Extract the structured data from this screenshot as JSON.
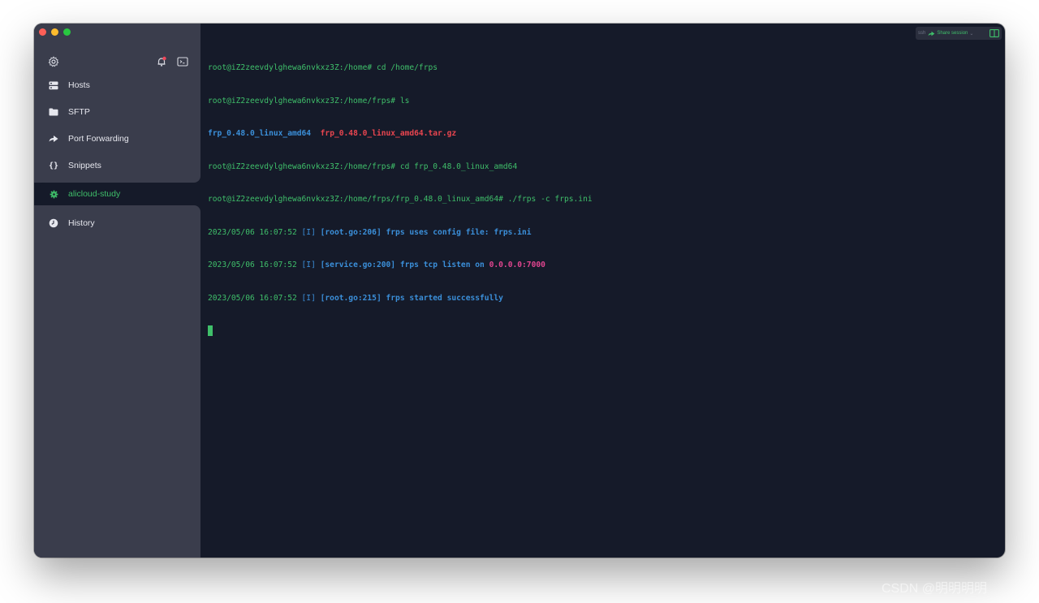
{
  "window": {
    "title": ""
  },
  "sidebar": {
    "nav": [
      {
        "label": "Hosts",
        "icon": "hosts-icon"
      },
      {
        "label": "SFTP",
        "icon": "folder-icon"
      },
      {
        "label": "Port Forwarding",
        "icon": "forward-arrow-icon"
      },
      {
        "label": "Snippets",
        "icon": "braces-icon"
      }
    ],
    "session": {
      "label": "alicloud-study",
      "icon": "gear-icon"
    },
    "history": {
      "label": "History",
      "icon": "clock-icon"
    }
  },
  "toolbar": {
    "tag": "ssh",
    "share_label": "Share session",
    "chevron": "⌄"
  },
  "terminal": {
    "lines": [
      {
        "prompt": "root@iZ2zeevdylghewa6nvkxz3Z:/home#",
        "cmd": " cd /home/frps"
      },
      {
        "prompt": "root@iZ2zeevdylghewa6nvkxz3Z:/home/frps#",
        "cmd": " ls"
      },
      {
        "dir": "frp_0.48.0_linux_amd64",
        "sep": "  ",
        "archive": "frp_0.48.0_linux_amd64.tar.gz"
      },
      {
        "prompt": "root@iZ2zeevdylghewa6nvkxz3Z:/home/frps#",
        "cmd": " cd frp_0.48.0_linux_amd64"
      },
      {
        "prompt": "root@iZ2zeevdylghewa6nvkxz3Z:/home/frps/frp_0.48.0_linux_amd64#",
        "cmd": " ./frps -c frps.ini"
      },
      {
        "ts": "2023/05/06 16:07:52",
        "lvl": " [I]",
        "src": " [root.go:206]",
        "msg": " frps uses config file: frps.ini",
        "hl": ""
      },
      {
        "ts": "2023/05/06 16:07:52",
        "lvl": " [I]",
        "src": " [service.go:200]",
        "msg": " frps tcp listen on ",
        "hl": "0.0.0.0:7000"
      },
      {
        "ts": "2023/05/06 16:07:52",
        "lvl": " [I]",
        "src": " [root.go:215]",
        "msg": " frps started successfully",
        "hl": ""
      }
    ]
  },
  "watermark": "CSDN @明明明明",
  "colors": {
    "sidebar_bg": "#3a3d4c",
    "terminal_bg": "#151a29",
    "accent_green": "#3fbf6a",
    "info_blue": "#3b8fd9",
    "error_red": "#e8454f",
    "highlight_pink": "#e0458f"
  }
}
